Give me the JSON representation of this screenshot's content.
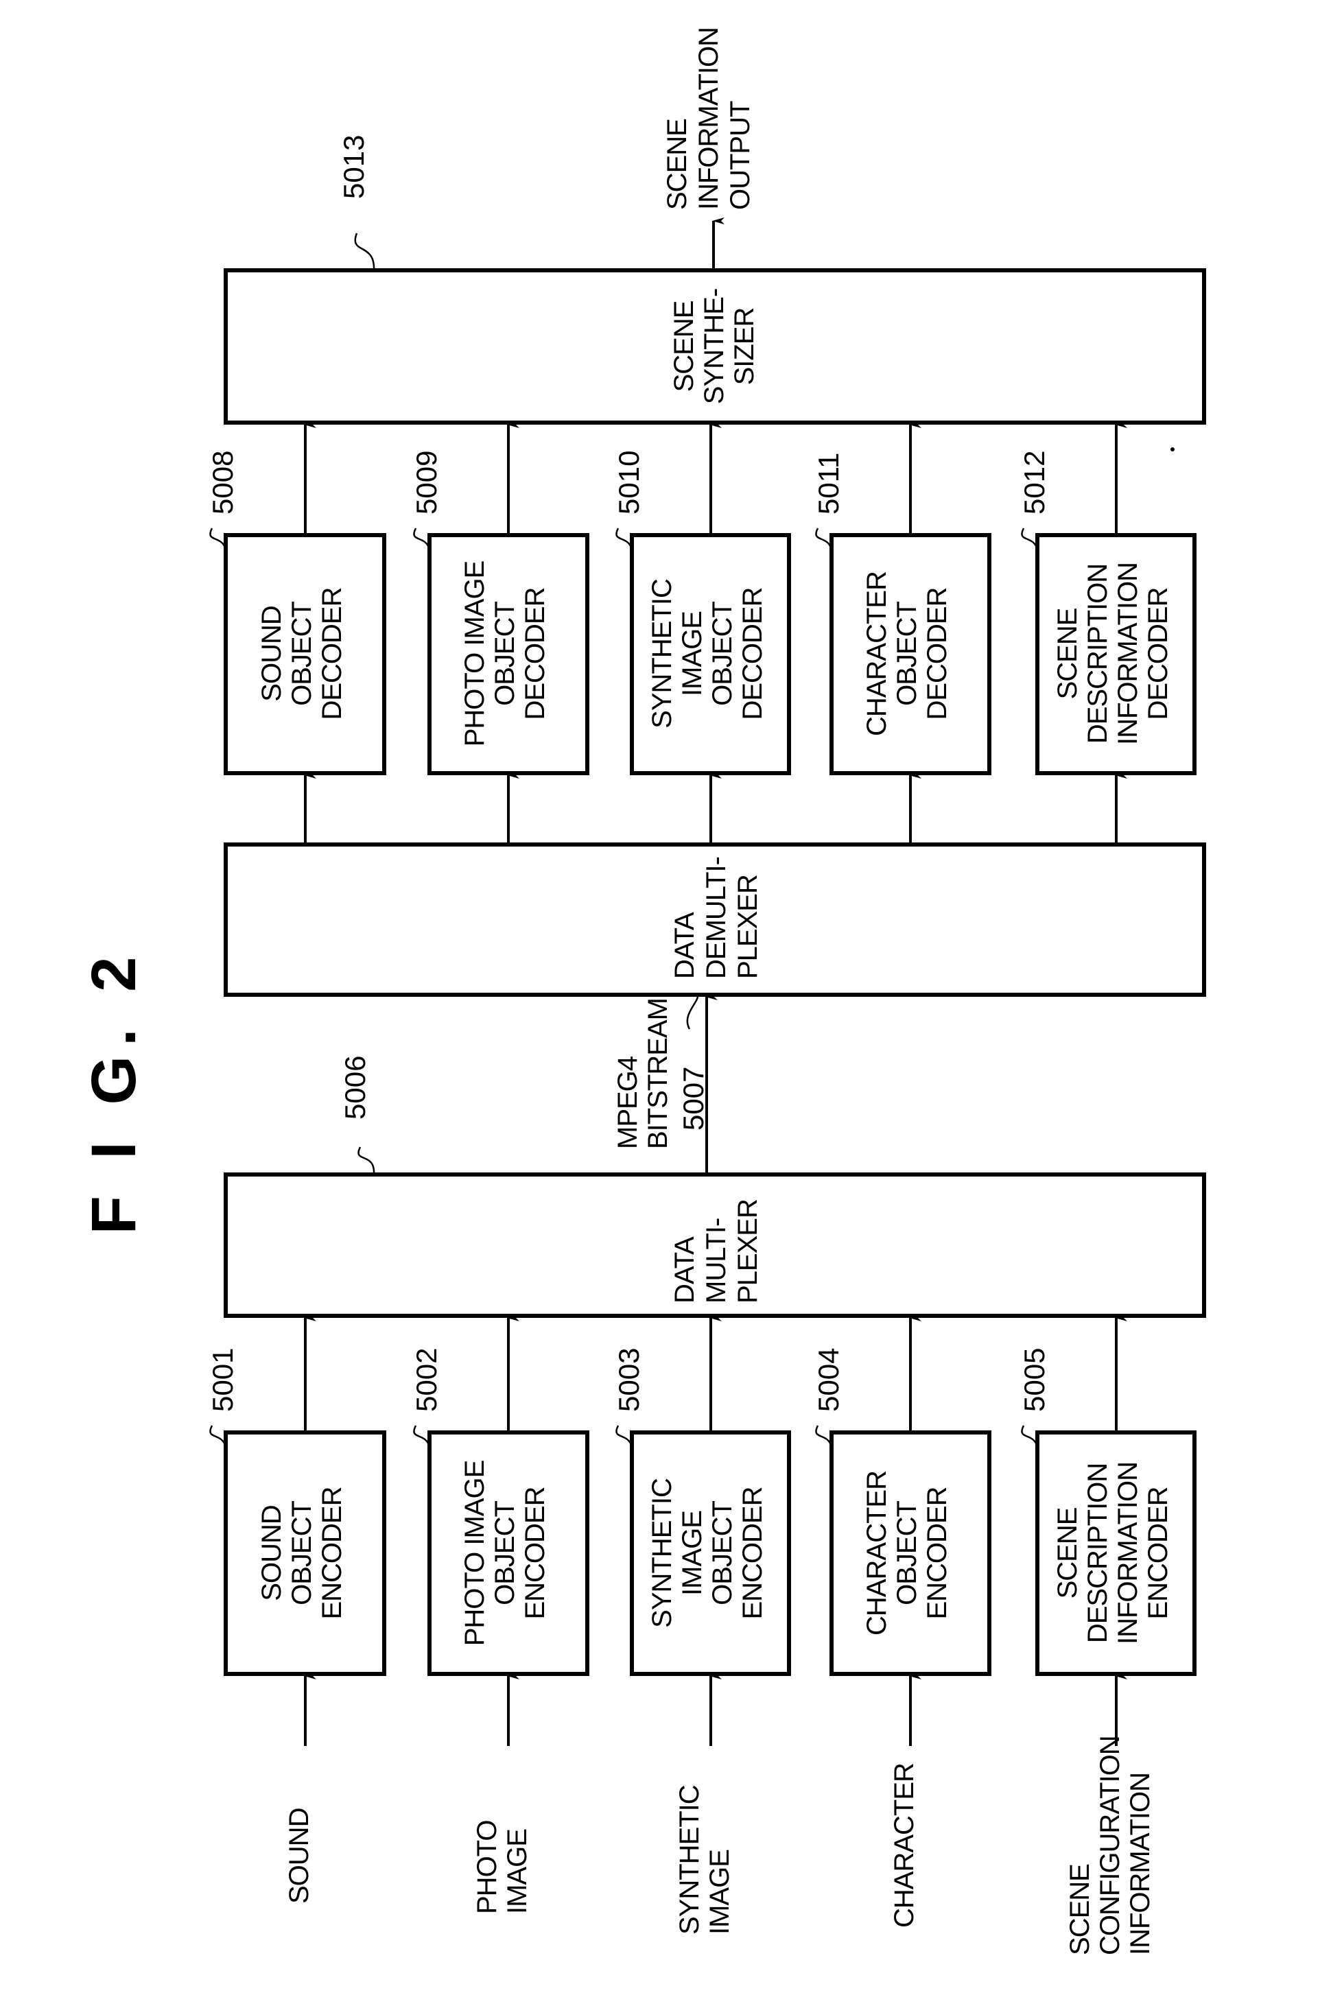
{
  "figure": {
    "title": "F I G. 2"
  },
  "colors": {
    "ink": "#000000",
    "paper": "#ffffff"
  },
  "inputs": [
    {
      "lines": [
        "SOUND"
      ]
    },
    {
      "lines": [
        "PHOTO",
        "IMAGE"
      ]
    },
    {
      "lines": [
        "SYNTHETIC",
        "IMAGE"
      ]
    },
    {
      "lines": [
        "CHARACTER"
      ]
    },
    {
      "lines": [
        "SCENE",
        "CONFIGURATION",
        "INFORMATION"
      ]
    }
  ],
  "encoders": [
    {
      "ref": "5001",
      "lines": [
        "SOUND",
        "OBJECT",
        "ENCODER"
      ]
    },
    {
      "ref": "5002",
      "lines": [
        "PHOTO IMAGE",
        "OBJECT",
        "ENCODER"
      ]
    },
    {
      "ref": "5003",
      "lines": [
        "SYNTHETIC",
        "IMAGE",
        "OBJECT",
        "ENCODER"
      ]
    },
    {
      "ref": "5004",
      "lines": [
        "CHARACTER",
        "OBJECT",
        "ENCODER"
      ]
    },
    {
      "ref": "5005",
      "lines": [
        "SCENE",
        "DESCRIPTION",
        "INFORMATION",
        "ENCODER"
      ]
    }
  ],
  "multiplexer": {
    "ref": "5006",
    "lines": [
      "DATA",
      "MULTI-",
      "PLEXER"
    ]
  },
  "bitstream": {
    "ref": "5007",
    "lines": [
      "MPEG4",
      "BITSTREAM"
    ]
  },
  "demultiplexer": {
    "lines": [
      "DATA",
      "DEMULTI-",
      "PLEXER"
    ]
  },
  "decoders": [
    {
      "ref": "5008",
      "lines": [
        "SOUND",
        "OBJECT",
        "DECODER"
      ]
    },
    {
      "ref": "5009",
      "lines": [
        "PHOTO IMAGE",
        "OBJECT",
        "DECODER"
      ]
    },
    {
      "ref": "5010",
      "lines": [
        "SYNTHETIC",
        "IMAGE",
        "OBJECT",
        "DECODER"
      ]
    },
    {
      "ref": "5011",
      "lines": [
        "CHARACTER",
        "OBJECT",
        "DECODER"
      ]
    },
    {
      "ref": "5012",
      "lines": [
        "SCENE",
        "DESCRIPTION",
        "INFORMATION",
        "DECODER"
      ]
    }
  ],
  "synthesizer": {
    "ref": "5013",
    "lines": [
      "SCENE",
      "SYNTHE-",
      "SIZER"
    ]
  },
  "output": {
    "lines": [
      "SCENE",
      "INFORMATION",
      "OUTPUT"
    ]
  }
}
